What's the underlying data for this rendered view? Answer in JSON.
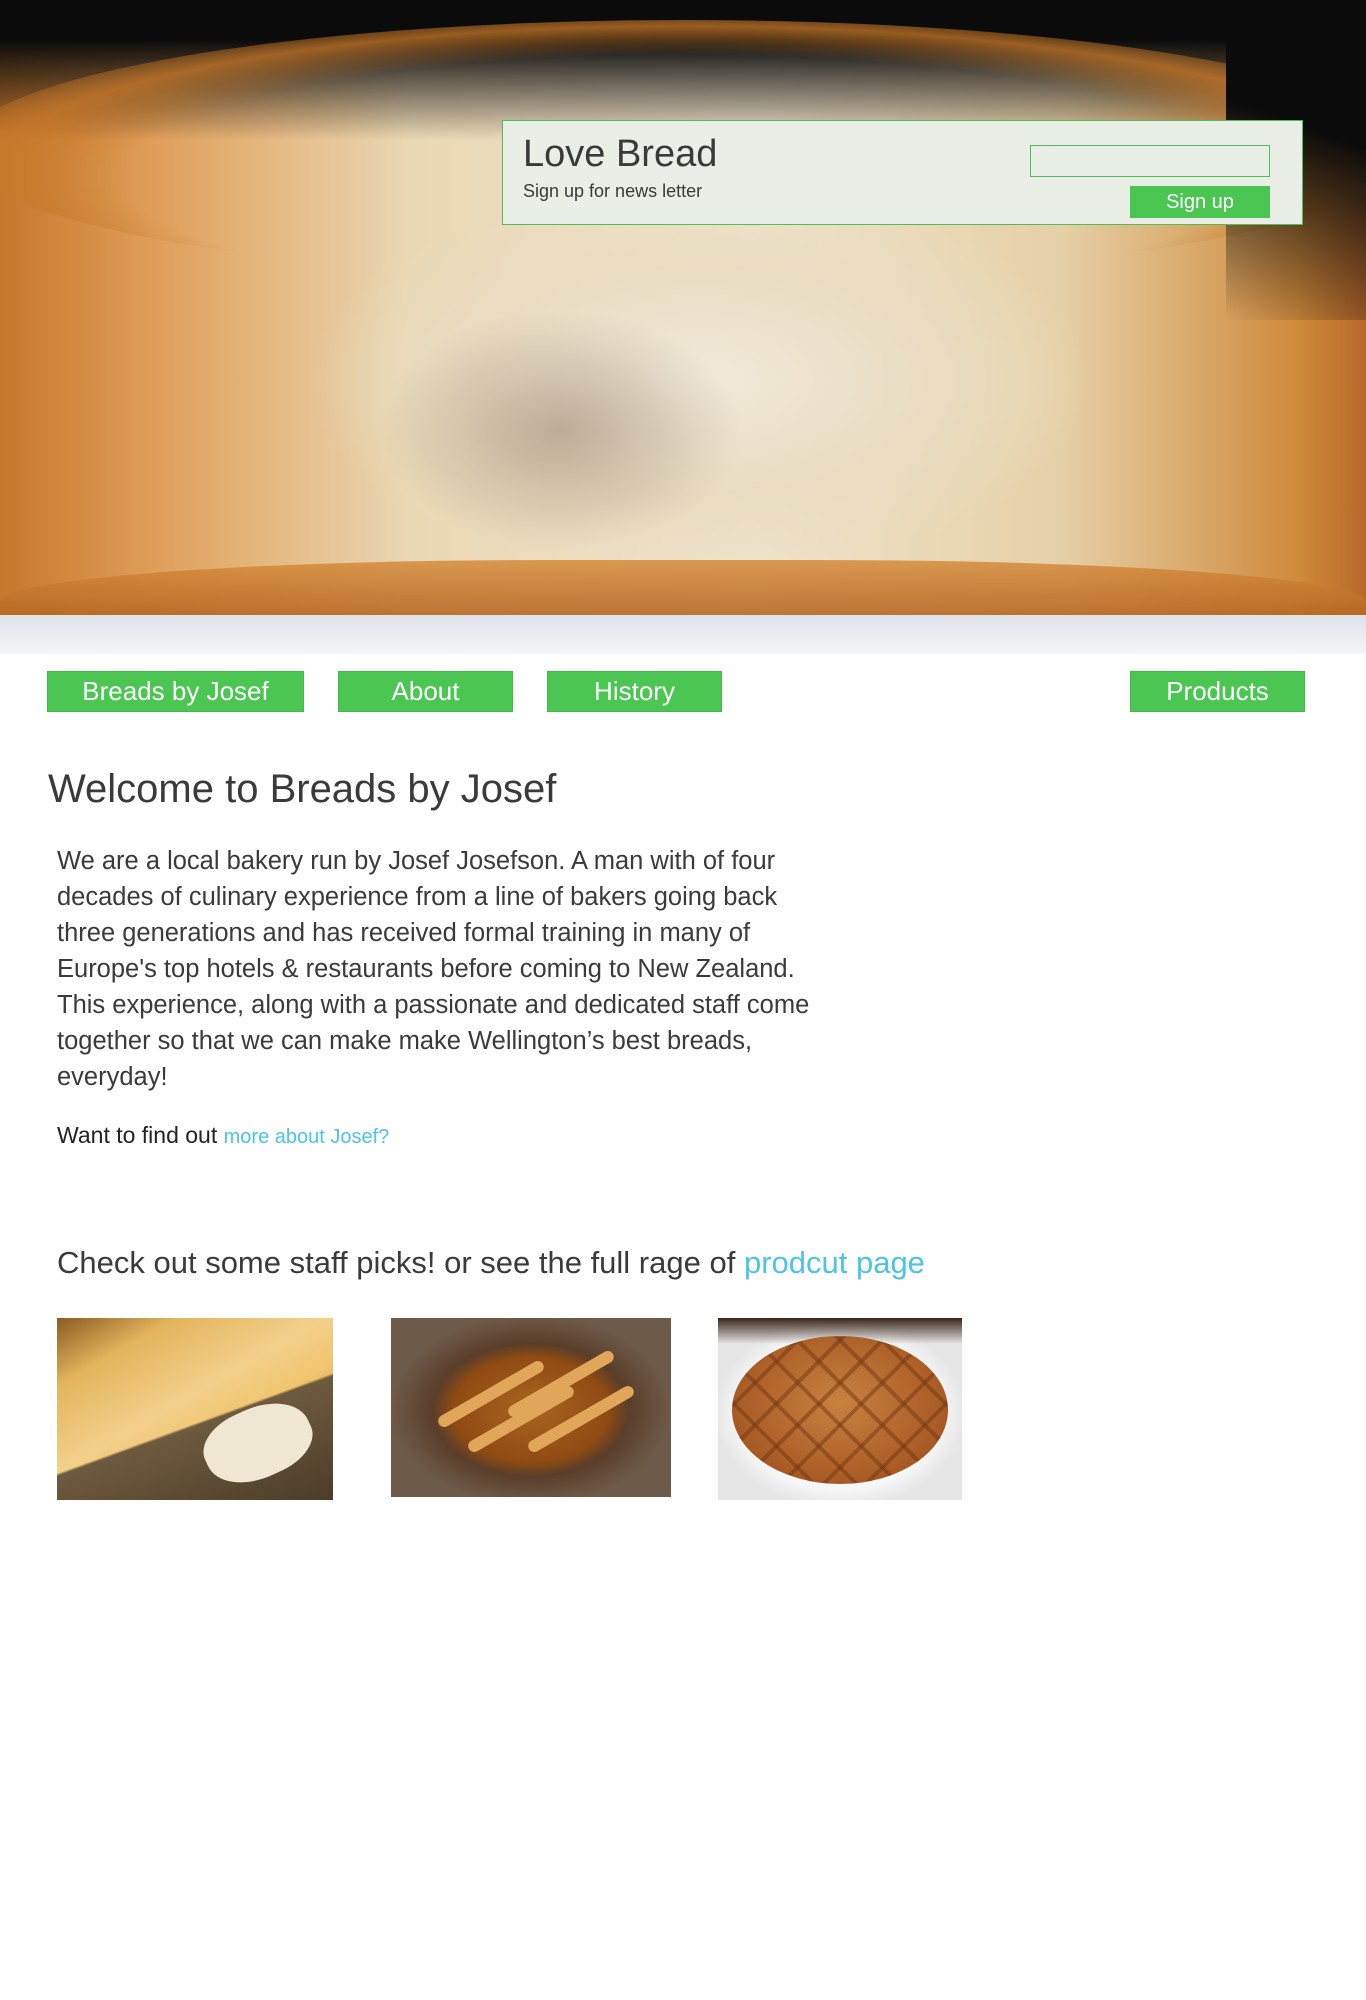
{
  "newsletter": {
    "title": "Love Bread",
    "subtitle": "Sign up for news letter",
    "email_value": "",
    "signup_label": "Sign up"
  },
  "nav": {
    "brand": "Breads by Josef",
    "about": "About",
    "history": "History",
    "products": "Products"
  },
  "main": {
    "heading": "Welcome to Breads by Josef",
    "intro": "We are a local bakery run by Josef Josefson. A man with of four decades of culinary experience from a line of bakers going back three generations and has received formal training in many of Europe's top hotels & restaurants before coming to New Zealand. This experience, along with a passionate and dedicated staff come together so that we can make make Wellington’s best breads, everyday!",
    "find_out_prefix": "Want to find out",
    "find_out_link": "more about Josef?",
    "picks_prefix": "Check out some staff picks! or see the full rage of",
    "picks_link": "prodcut page"
  },
  "colors": {
    "accent": "#4cc653",
    "link": "#4dc3e6",
    "text": "#3a3a3a",
    "panel": "#e9eee7"
  }
}
